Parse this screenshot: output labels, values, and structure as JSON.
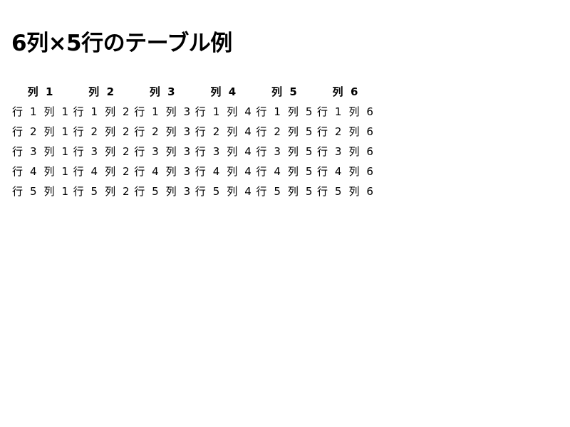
{
  "title": "6列×5行のテーブル例",
  "table": {
    "headers": [
      "列 1",
      "列 2",
      "列 3",
      "列 4",
      "列 5",
      "列 6"
    ],
    "rows": [
      [
        "行 1 列 1",
        "行 1 列 2",
        "行 1 列 3",
        "行 1 列 4",
        "行 1 列 5",
        "行 1 列 6"
      ],
      [
        "行 2 列 1",
        "行 2 列 2",
        "行 2 列 3",
        "行 2 列 4",
        "行 2 列 5",
        "行 2 列 6"
      ],
      [
        "行 3 列 1",
        "行 3 列 2",
        "行 3 列 3",
        "行 3 列 4",
        "行 3 列 5",
        "行 3 列 6"
      ],
      [
        "行 4 列 1",
        "行 4 列 2",
        "行 4 列 3",
        "行 4 列 4",
        "行 4 列 5",
        "行 4 列 6"
      ],
      [
        "行 5 列 1",
        "行 5 列 2",
        "行 5 列 3",
        "行 5 列 4",
        "行 5 列 5",
        "行 5 列 6"
      ]
    ]
  }
}
